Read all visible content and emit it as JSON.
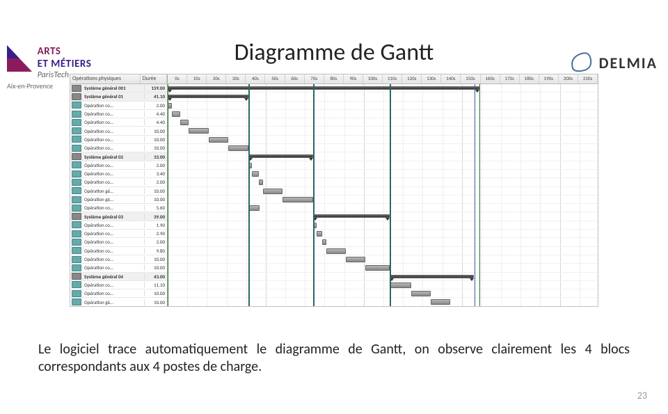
{
  "logos": {
    "left_line1": "ARTS",
    "left_line2": "ET MÉTIERS",
    "left_line3": "ParisTech",
    "left_line4": "Aix-en-Provence",
    "right_ds": "DS",
    "right_name": "DELMIA"
  },
  "title": "Diagramme de Gantt",
  "caption": "Le logiciel trace automatiquement le diagramme de Gantt, on observe clairement les 4 blocs correspondants aux 4 postes de charge.",
  "page_number": "23",
  "gantt": {
    "header_left": {
      "col1": "Opérations physiques",
      "col2": "Durée"
    },
    "time_axis": {
      "start": 0,
      "end": 220,
      "step": 10
    },
    "ticks": [
      "0s",
      "10s",
      "20s",
      "30s",
      "40s",
      "50s",
      "60s",
      "70s",
      "80s",
      "90s",
      "100s",
      "110s",
      "120s",
      "130s",
      "140s",
      "150s",
      "160s",
      "170s",
      "180s",
      "190s",
      "200s",
      "210s"
    ],
    "rows": [
      {
        "type": "group",
        "name": "Système général 001",
        "dur": "159.00",
        "start": 0,
        "len": 159
      },
      {
        "type": "group",
        "name": "Système général 01",
        "dur": "41.10",
        "start": 0,
        "len": 41.1
      },
      {
        "type": "task",
        "name": "Opération co…",
        "dur": "2.00",
        "start": 0,
        "len": 2
      },
      {
        "type": "task",
        "name": "Opération co…",
        "dur": "4.40",
        "start": 2,
        "len": 4.4
      },
      {
        "type": "task",
        "name": "Opération co…",
        "dur": "4.40",
        "start": 6.4,
        "len": 4.4
      },
      {
        "type": "task",
        "name": "Opération co…",
        "dur": "10.00",
        "start": 10.8,
        "len": 10
      },
      {
        "type": "task",
        "name": "Opération co…",
        "dur": "10.00",
        "start": 20.8,
        "len": 10
      },
      {
        "type": "task",
        "name": "Opération co…",
        "dur": "10.00",
        "start": 30.8,
        "len": 10.3
      },
      {
        "type": "group",
        "name": "Système général 02",
        "dur": "33.00",
        "start": 41.1,
        "len": 33
      },
      {
        "type": "task",
        "name": "Opération co…",
        "dur": "2.00",
        "start": 41.1,
        "len": 2
      },
      {
        "type": "task",
        "name": "Opération co…",
        "dur": "3.40",
        "start": 43.1,
        "len": 3.4
      },
      {
        "type": "task",
        "name": "Opération co…",
        "dur": "2.00",
        "start": 46.5,
        "len": 2
      },
      {
        "type": "task",
        "name": "Opération gé…",
        "dur": "10.00",
        "start": 48.5,
        "len": 10
      },
      {
        "type": "task",
        "name": "Opération gé…",
        "dur": "10.00",
        "start": 58.5,
        "len": 15.6
      },
      {
        "type": "task",
        "name": "Opération co…",
        "dur": "5.60",
        "start": 41.1,
        "len": 5.6
      },
      {
        "type": "group",
        "name": "Système général 03",
        "dur": "39.00",
        "start": 74.1,
        "len": 39
      },
      {
        "type": "task",
        "name": "Opération co…",
        "dur": "1.90",
        "start": 74.1,
        "len": 1.9
      },
      {
        "type": "task",
        "name": "Opération co…",
        "dur": "2.90",
        "start": 76,
        "len": 2.9
      },
      {
        "type": "task",
        "name": "Opération co…",
        "dur": "2.00",
        "start": 78.9,
        "len": 2
      },
      {
        "type": "task",
        "name": "Opération co…",
        "dur": "9.80",
        "start": 80.9,
        "len": 9.8
      },
      {
        "type": "task",
        "name": "Opération co…",
        "dur": "10.00",
        "start": 90.7,
        "len": 10
      },
      {
        "type": "task",
        "name": "Opération co…",
        "dur": "10.00",
        "start": 100.7,
        "len": 12.4
      },
      {
        "type": "group",
        "name": "Système général 04",
        "dur": "43.00",
        "start": 113.1,
        "len": 43
      },
      {
        "type": "task",
        "name": "Opération co…",
        "dur": "11.10",
        "start": 113.1,
        "len": 11.1
      },
      {
        "type": "task",
        "name": "Opération co…",
        "dur": "10.00",
        "start": 124.2,
        "len": 10
      },
      {
        "type": "task",
        "name": "Opération gé…",
        "dur": "10.00",
        "start": 134.2,
        "len": 10
      },
      {
        "type": "task",
        "name": "Opération gé…",
        "dur": "10.00",
        "start": 144.2,
        "len": 14.8
      }
    ],
    "vlines_green": [
      0,
      41.1,
      74.1,
      113.1,
      159
    ],
    "vlines_blue": [
      41.1,
      74.1,
      113.1,
      156
    ]
  }
}
